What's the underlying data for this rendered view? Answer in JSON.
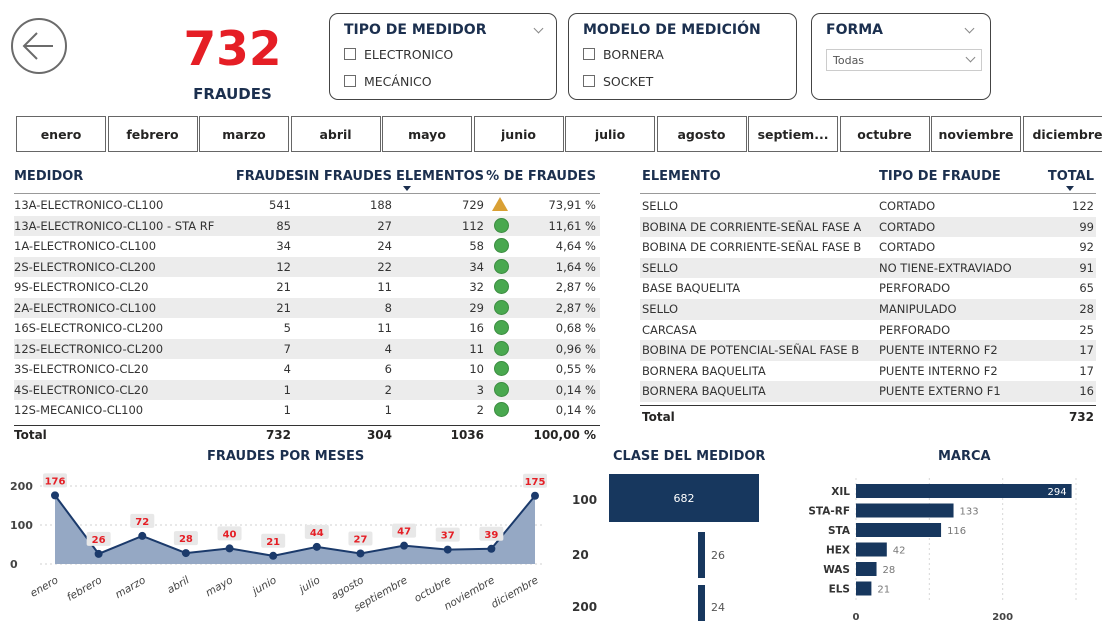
{
  "kpi": {
    "value": "732",
    "label": "FRAUDES"
  },
  "slicers": {
    "tipo": {
      "title": "TIPO DE MEDIDOR",
      "options": [
        "ELECTRONICO",
        "MECÁNICO"
      ]
    },
    "modelo": {
      "title": "MODELO DE MEDICIÓN",
      "options": [
        "BORNERA",
        "SOCKET"
      ]
    },
    "forma": {
      "title": "FORMA",
      "selected": "Todas"
    }
  },
  "months": [
    "enero",
    "febrero",
    "marzo",
    "abril",
    "mayo",
    "junio",
    "julio",
    "agosto",
    "septiem...",
    "octubre",
    "noviembre",
    "diciembre"
  ],
  "medidor_table": {
    "headers": [
      "MEDIDOR",
      "FRAUDES",
      "SIN FRAUDES",
      "ELEMENTOS",
      "% DE FRAUDES"
    ],
    "rows": [
      [
        "13A-ELECTRONICO-CL100",
        "541",
        "188",
        "729",
        "73,91 %"
      ],
      [
        "13A-ELECTRONICO-CL100 - STA RF",
        "85",
        "27",
        "112",
        "11,61 %"
      ],
      [
        "1A-ELECTRONICO-CL100",
        "34",
        "24",
        "58",
        "4,64 %"
      ],
      [
        "2S-ELECTRONICO-CL200",
        "12",
        "22",
        "34",
        "1,64 %"
      ],
      [
        "9S-ELECTRONICO-CL20",
        "21",
        "11",
        "32",
        "2,87 %"
      ],
      [
        "2A-ELECTRONICO-CL100",
        "21",
        "8",
        "29",
        "2,87 %"
      ],
      [
        "16S-ELECTRONICO-CL200",
        "5",
        "11",
        "16",
        "0,68 %"
      ],
      [
        "12S-ELECTRONICO-CL200",
        "7",
        "4",
        "11",
        "0,96 %"
      ],
      [
        "3S-ELECTRONICO-CL20",
        "4",
        "6",
        "10",
        "0,55 %"
      ],
      [
        "4S-ELECTRONICO-CL20",
        "1",
        "2",
        "3",
        "0,14 %"
      ],
      [
        "12S-MECANICO-CL100",
        "1",
        "1",
        "2",
        "0,14 %"
      ]
    ],
    "icons": [
      "warning-triangle",
      "green-circle",
      "green-circle",
      "green-circle",
      "green-circle",
      "green-circle",
      "green-circle",
      "green-circle",
      "green-circle",
      "green-circle",
      "green-circle"
    ],
    "total": [
      "Total",
      "732",
      "304",
      "1036",
      "100,00 %"
    ]
  },
  "elemento_table": {
    "headers": [
      "ELEMENTO",
      "TIPO DE FRAUDE",
      "TOTAL"
    ],
    "rows": [
      [
        "SELLO",
        "CORTADO",
        "122"
      ],
      [
        "BOBINA DE CORRIENTE-SEÑAL FASE A",
        "CORTADO",
        "99"
      ],
      [
        "BOBINA DE CORRIENTE-SEÑAL FASE B",
        "CORTADO",
        "92"
      ],
      [
        "SELLO",
        "NO TIENE-EXTRAVIADO",
        "91"
      ],
      [
        "BASE BAQUELITA",
        "PERFORADO",
        "65"
      ],
      [
        "SELLO",
        "MANIPULADO",
        "28"
      ],
      [
        "CARCASA",
        "PERFORADO",
        "25"
      ],
      [
        "BOBINA DE POTENCIAL-SEÑAL FASE B",
        "PUENTE INTERNO F2",
        "17"
      ],
      [
        "BORNERA BAQUELITA",
        "PUENTE INTERNO F2",
        "17"
      ],
      [
        "BORNERA BAQUELITA",
        "PUENTE EXTERNO F1",
        "16"
      ]
    ],
    "total": [
      "Total",
      "732"
    ]
  },
  "chart_data": [
    {
      "type": "area",
      "title": "FRAUDES POR MESES",
      "categories": [
        "enero",
        "febrero",
        "marzo",
        "abril",
        "mayo",
        "junio",
        "julio",
        "agosto",
        "septiembre",
        "octubre",
        "noviembre",
        "diciembre"
      ],
      "values": [
        176,
        26,
        72,
        28,
        40,
        21,
        44,
        27,
        47,
        37,
        39,
        175
      ],
      "yticks": [
        "0",
        "100",
        "200"
      ],
      "ylim": [
        0,
        200
      ],
      "color": "#1b3a6b",
      "fill": "#95a8c4",
      "label_color": "#e51e25"
    },
    {
      "type": "bar",
      "title": "CLASE DEL MEDIDOR",
      "categories": [
        "100",
        "20",
        "200"
      ],
      "values": [
        682,
        26,
        24
      ],
      "color": "#17375e"
    },
    {
      "type": "bar",
      "title": "MARCA",
      "categories": [
        "XIL",
        "STA-RF",
        "STA",
        "HEX",
        "WAS",
        "ELS"
      ],
      "values": [
        294,
        133,
        116,
        42,
        28,
        21
      ],
      "xticks": [
        "0",
        "200"
      ],
      "xlim": [
        0,
        300
      ],
      "color": "#17375e"
    }
  ]
}
